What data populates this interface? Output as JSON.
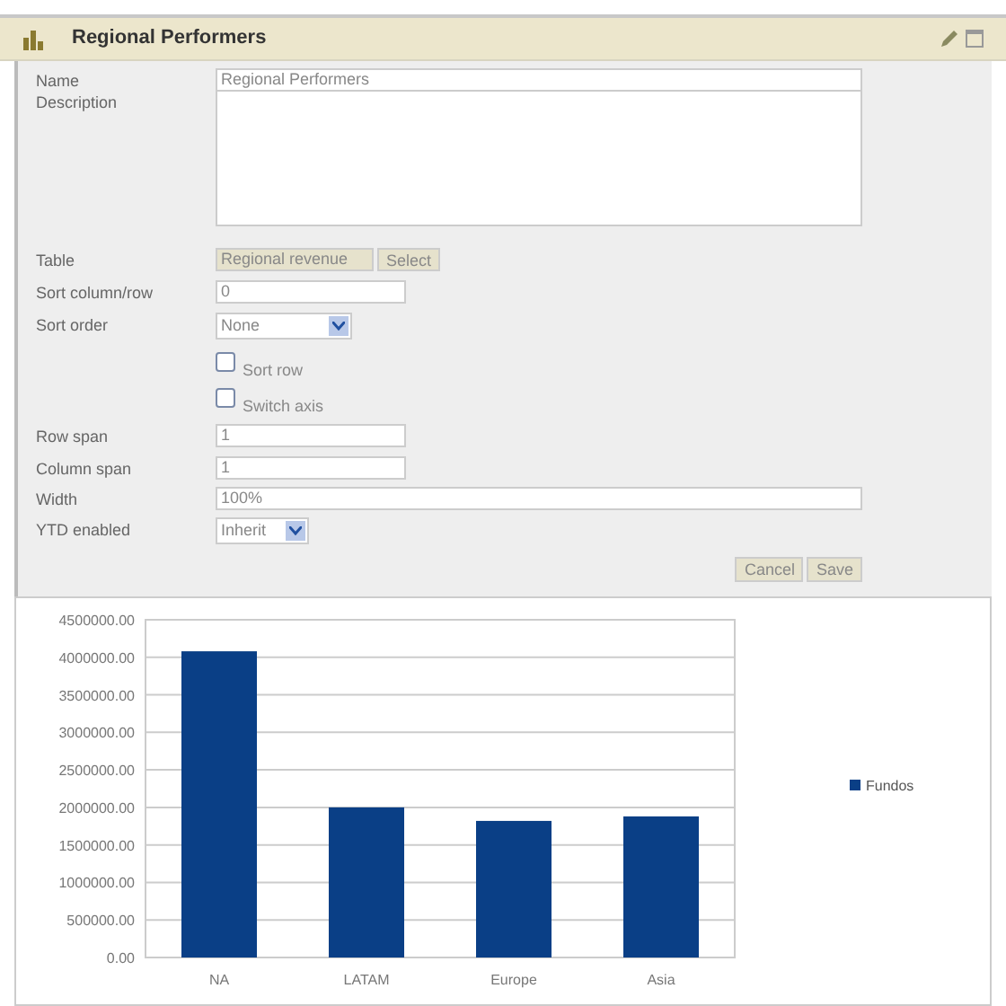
{
  "window": {
    "title": "Regional Performers"
  },
  "form": {
    "name": {
      "label": "Name",
      "value": "Regional Performers"
    },
    "description": {
      "label": "Description"
    },
    "table": {
      "label": "Table",
      "value": "Regional revenue",
      "button": "Select"
    },
    "sort_column": {
      "label": "Sort column/row",
      "value": "0"
    },
    "sort_order": {
      "label": "Sort order",
      "value": "None"
    },
    "checkboxes": [
      {
        "label": "Sort row",
        "checked": false
      },
      {
        "label": "Switch axis",
        "checked": false
      }
    ],
    "row_span": {
      "label": "Row span",
      "value": "1"
    },
    "column_span": {
      "label": "Column span",
      "value": "1"
    },
    "width": {
      "label": "Width",
      "value": "100%"
    },
    "ytd": {
      "label": "YTD enabled",
      "value": "Inherit"
    },
    "buttons": [
      "Cancel",
      "Save"
    ]
  },
  "chart": {
    "chart_data": {
      "type": "bar",
      "categories": [
        "NA",
        "LATAM",
        "Europe",
        "Asia"
      ],
      "series": [
        {
          "name": "Fundos",
          "color": "#0a3f86",
          "values": [
            4080000,
            2000000,
            1820000,
            1880000
          ]
        }
      ],
      "ylim": [
        0,
        4500000
      ],
      "grid": true,
      "yticks": [
        {
          "value": 0,
          "label": "0.00"
        },
        {
          "value": 500000,
          "label": "500000.00"
        },
        {
          "value": 1000000,
          "label": "1000000.00"
        },
        {
          "value": 1500000,
          "label": "1500000.00"
        },
        {
          "value": 2000000,
          "label": "2000000.00"
        },
        {
          "value": 2500000,
          "label": "2500000.00"
        },
        {
          "value": 3000000,
          "label": "3000000.00"
        },
        {
          "value": 3500000,
          "label": "3500000.00"
        },
        {
          "value": 4000000,
          "label": "4000000.00"
        },
        {
          "value": 4500000,
          "label": "4500000.00"
        }
      ]
    }
  }
}
